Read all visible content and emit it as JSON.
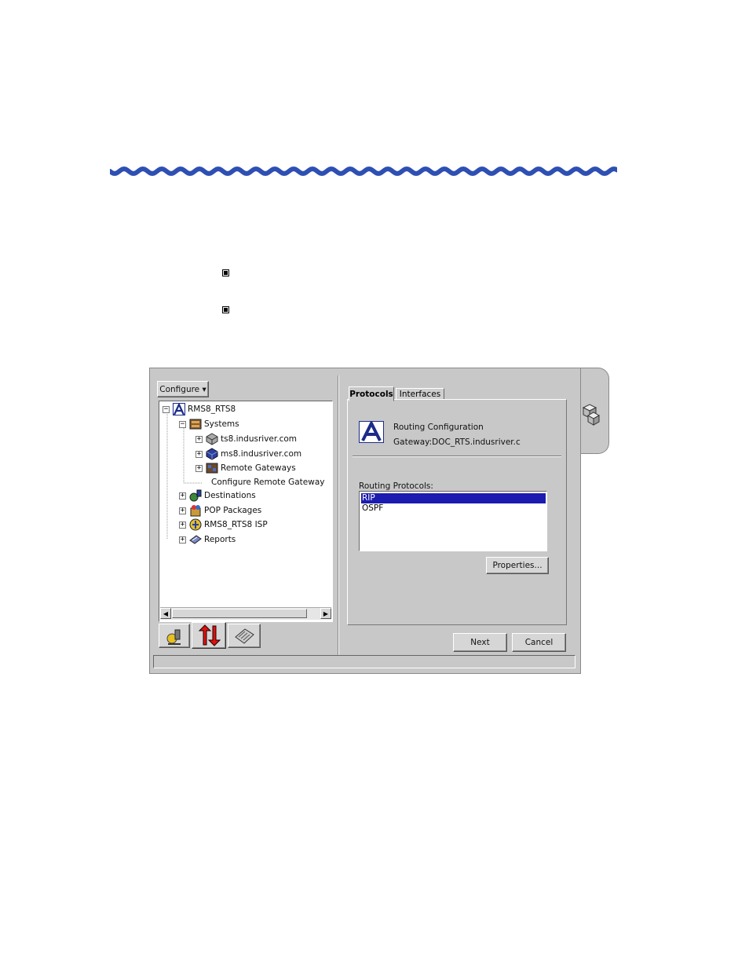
{
  "page": {
    "bullets": [
      "",
      ""
    ]
  },
  "app": {
    "menu": {
      "configure_label": "Configure ▾"
    },
    "tree": {
      "items": [
        {
          "label": "RMS8_RTS8",
          "icon": "app-logo-icon",
          "toggle": "−"
        },
        {
          "label": "Systems",
          "icon": "systems-icon",
          "toggle": "−"
        },
        {
          "label": "ts8.indusriver.com",
          "icon": "server-icon",
          "toggle": "+"
        },
        {
          "label": "ms8.indusriver.com",
          "icon": "server-blue-icon",
          "toggle": "+"
        },
        {
          "label": "Remote Gateways",
          "icon": "gateway-icon",
          "toggle": "+"
        },
        {
          "label": "Configure Remote Gateway",
          "icon": "",
          "toggle": ""
        },
        {
          "label": "Destinations",
          "icon": "destinations-icon",
          "toggle": "+"
        },
        {
          "label": "POP Packages",
          "icon": "packages-icon",
          "toggle": "+"
        },
        {
          "label": "RMS8_RTS8 ISP",
          "icon": "isp-icon",
          "toggle": "+"
        },
        {
          "label": "Reports",
          "icon": "reports-icon",
          "toggle": "+"
        }
      ]
    },
    "bottom_tabs": [
      "wizard-icon",
      "traffic-arrows-icon",
      "keyboard-icon"
    ],
    "tabs": [
      {
        "label": "Protocols",
        "active": true
      },
      {
        "label": "Interfaces",
        "active": false
      }
    ],
    "header": {
      "title": "Routing Configuration",
      "gateway": "Gateway:DOC_RTS.indusriver.c"
    },
    "routing_protocols_label": "Routing Protocols:",
    "protocols": [
      {
        "label": "RIP",
        "selected": true
      },
      {
        "label": "OSPF",
        "selected": false
      }
    ],
    "buttons": {
      "properties": "Properties...",
      "next": "Next",
      "cancel": "Cancel"
    },
    "colors": {
      "selection": "#1b1bb0",
      "wave": "#2e4fb3",
      "window_bg": "#c8c8c8"
    }
  }
}
